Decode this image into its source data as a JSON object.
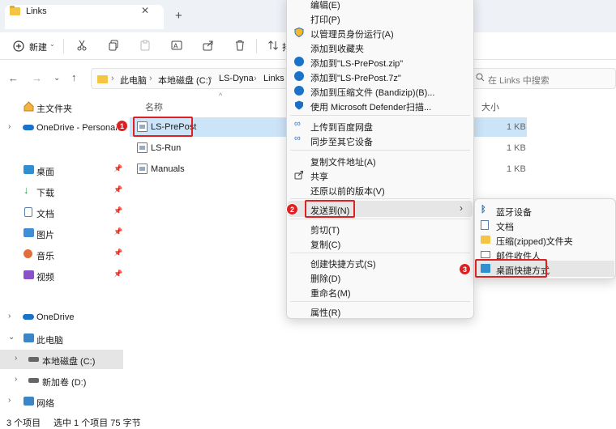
{
  "window": {
    "tab_title": "Links",
    "tab_close": "✕",
    "tab_add": "+"
  },
  "toolbar": {
    "new_label": "新建",
    "partial_label": "排"
  },
  "address": {
    "crumbs": [
      "此电脑",
      "本地磁盘 (C:)",
      "LS-Dyna",
      "Links"
    ],
    "search_placeholder": "在 Links 中搜索"
  },
  "nav": {
    "home": "主文件夹",
    "onedrive_personal": "OneDrive - Personal",
    "quick": [
      "桌面",
      "下载",
      "文档",
      "图片",
      "音乐",
      "视频"
    ],
    "onedrive": "OneDrive",
    "this_pc": "此电脑",
    "local_disk": "本地磁盘 (C:)",
    "new_volume": "新加卷 (D:)",
    "network": "网络"
  },
  "content": {
    "col_name": "名称",
    "col_size": "大小",
    "files": [
      {
        "name": "LS-PrePost",
        "size": "1 KB"
      },
      {
        "name": "LS-Run",
        "size": "1 KB"
      },
      {
        "name": "Manuals",
        "size": "1 KB"
      }
    ]
  },
  "status": {
    "count": "3 个项目",
    "selected": "选中 1 个项目  75 字节"
  },
  "context_menu": {
    "items": [
      "编辑(E)",
      "打印(P)",
      "以管理员身份运行(A)",
      "添加到收藏夹",
      "添加到\"LS-PrePost.zip\"",
      "添加到\"LS-PrePost.7z\"",
      "添加到压缩文件 (Bandizip)(B)...",
      "使用 Microsoft Defender扫描...",
      "上传到百度网盘",
      "同步至其它设备",
      "复制文件地址(A)",
      "共享",
      "还原以前的版本(V)",
      "发送到(N)",
      "剪切(T)",
      "复制(C)",
      "创建快捷方式(S)",
      "删除(D)",
      "重命名(M)",
      "属性(R)"
    ],
    "submenu_arrow": "›"
  },
  "send_to": {
    "items": [
      "蓝牙设备",
      "文档",
      "压缩(zipped)文件夹",
      "邮件收件人",
      "桌面快捷方式"
    ]
  },
  "badges": [
    "1",
    "2",
    "3"
  ],
  "colors": {
    "selection": "#cce4f7",
    "annotation": "#e02020",
    "accent": "#0067c0"
  }
}
